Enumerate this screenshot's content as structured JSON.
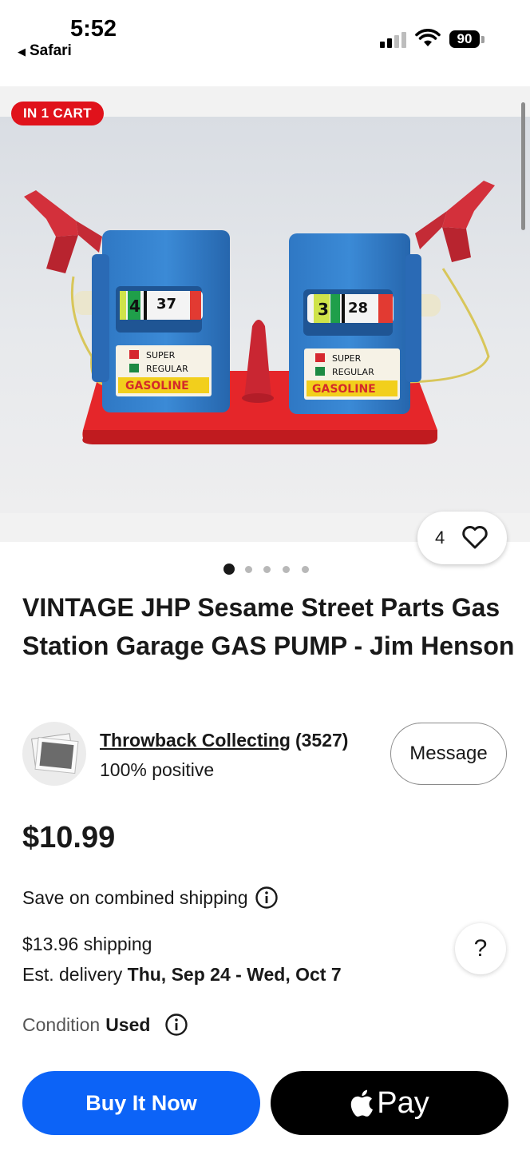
{
  "status_bar": {
    "time": "5:52",
    "back_app": "Safari",
    "battery": "90"
  },
  "hero": {
    "cart_badge": "IN 1 CART",
    "watch_count": "4",
    "image_count": 5,
    "active_image": 1
  },
  "photo": {
    "pump_left_numbers": [
      "4",
      "37"
    ],
    "pump_right_numbers": [
      "3",
      "28"
    ],
    "super_label": "SUPER",
    "regular_label": "REGULAR",
    "gasoline_label": "GASOLINE"
  },
  "listing": {
    "title": "VINTAGE JHP Sesame Street Parts Gas Station Garage GAS PUMP - Jim Henson",
    "price": "$10.99",
    "combined_shipping": "Save on combined shipping",
    "shipping_cost": "$13.96 shipping",
    "delivery_prefix": "Est. delivery",
    "delivery_dates": "Thu, Sep 24 - Wed, Oct 7",
    "condition_label": "Condition",
    "condition_value": "Used"
  },
  "seller": {
    "name": "Throwback Collecting",
    "feedback_count": "(3527)",
    "positive": "100% positive",
    "message_label": "Message"
  },
  "help": {
    "label": "?"
  },
  "actions": {
    "buy_now": "Buy It Now",
    "apple_pay": "Pay"
  },
  "colors": {
    "accent": "#0c63f7",
    "badge": "#e0121b"
  }
}
